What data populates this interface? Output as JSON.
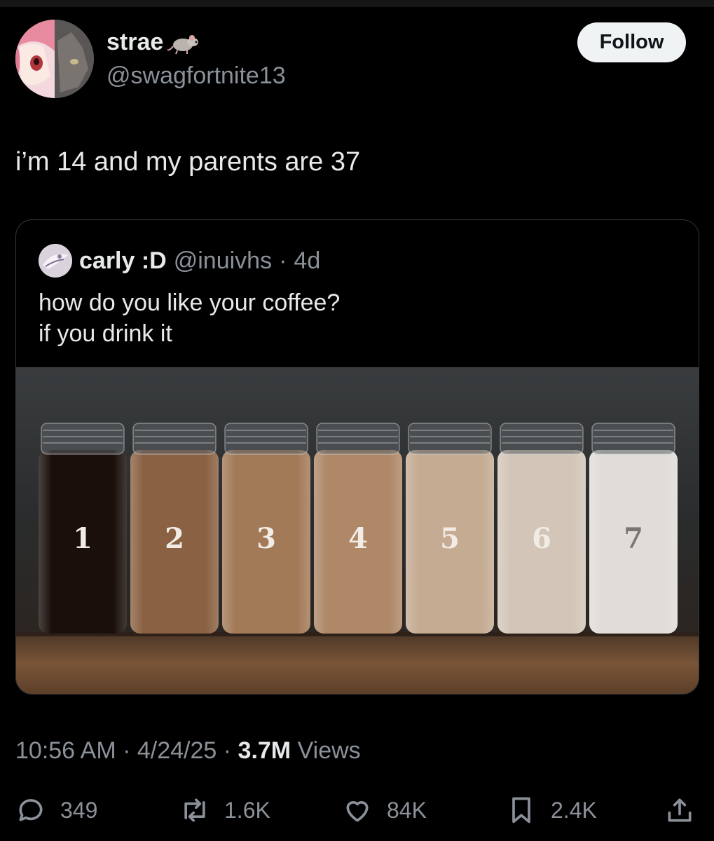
{
  "tweet": {
    "author": {
      "display_name": "strae",
      "handle": "@swagfortnite13",
      "emoji": "rat-emoji"
    },
    "follow_label": "Follow",
    "text": "i’m 14 and my parents are 37",
    "time": "10:56 AM",
    "date": "4/24/25",
    "sep1": " · ",
    "sep2": " · ",
    "views_count": "3.7M",
    "views_label": " Views"
  },
  "quote": {
    "display_name": "carly :D",
    "handle": "@inuivhs",
    "dot": "·",
    "age": "4d",
    "lines": [
      "how do you like your coffee?",
      "if you drink it"
    ],
    "jar_labels": [
      "1",
      "2",
      "3",
      "4",
      "5",
      "6",
      "7"
    ]
  },
  "actions": {
    "replies": "349",
    "reposts": "1.6K",
    "likes": "84K",
    "bookmarks": "2.4K"
  },
  "icons": [
    "reply-icon",
    "repost-icon",
    "like-icon",
    "bookmark-icon",
    "share-icon"
  ],
  "colors": {
    "background": "#000000",
    "text": "#e7e9ea",
    "secondary": "#8b9199",
    "follow_bg": "#eff3f4"
  }
}
